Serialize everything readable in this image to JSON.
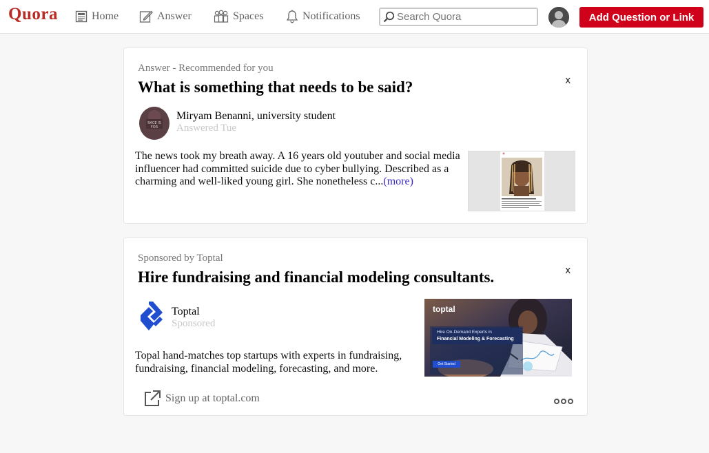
{
  "nav": {
    "logo": "Quora",
    "items": [
      {
        "label": "Home",
        "icon": "home-feed-icon"
      },
      {
        "label": "Answer",
        "icon": "pencil-icon"
      },
      {
        "label": "Spaces",
        "icon": "people-icon"
      },
      {
        "label": "Notifications",
        "icon": "bell-icon"
      }
    ],
    "search_placeholder": "Search Quora",
    "add_button": "Add Question or Link"
  },
  "cards": [
    {
      "eyebrow": "Answer - Recommended for you",
      "title": "What is something that needs to be said?",
      "close": "x",
      "author": "Miryam Benanni, university student",
      "author_sub": "Answered Tue",
      "avatar_text": "RACE IS FOR",
      "body_lines": [
        "The news took my breath away. A 16 years old youtuber and social media",
        "influencer had committed suicide due to cyber bullying. Described as a",
        "charming and well-liked young girl. She nonetheless c..."
      ],
      "more": "(more)"
    },
    {
      "eyebrow": "Sponsored by Toptal",
      "title": "Hire fundraising and financial modeling consultants.",
      "close": "x",
      "author": "Toptal",
      "author_sub": "Sponsored",
      "body_lines": [
        "Topal hand-matches top startups with experts in fundraising,",
        "fundraising, financial modeling, forecasting, and more."
      ],
      "ad": {
        "brand": "toptal",
        "line1": "Hire On-Demand Experts in",
        "line2": "Financial Modeling & Forecasting",
        "cta": "Get Started"
      },
      "footer_link": "Sign up at toptal.com"
    }
  ],
  "colors": {
    "brand": "#b92b27",
    "button": "#d0021b",
    "link": "#3b2bcc",
    "toptal": "#204ecf"
  }
}
